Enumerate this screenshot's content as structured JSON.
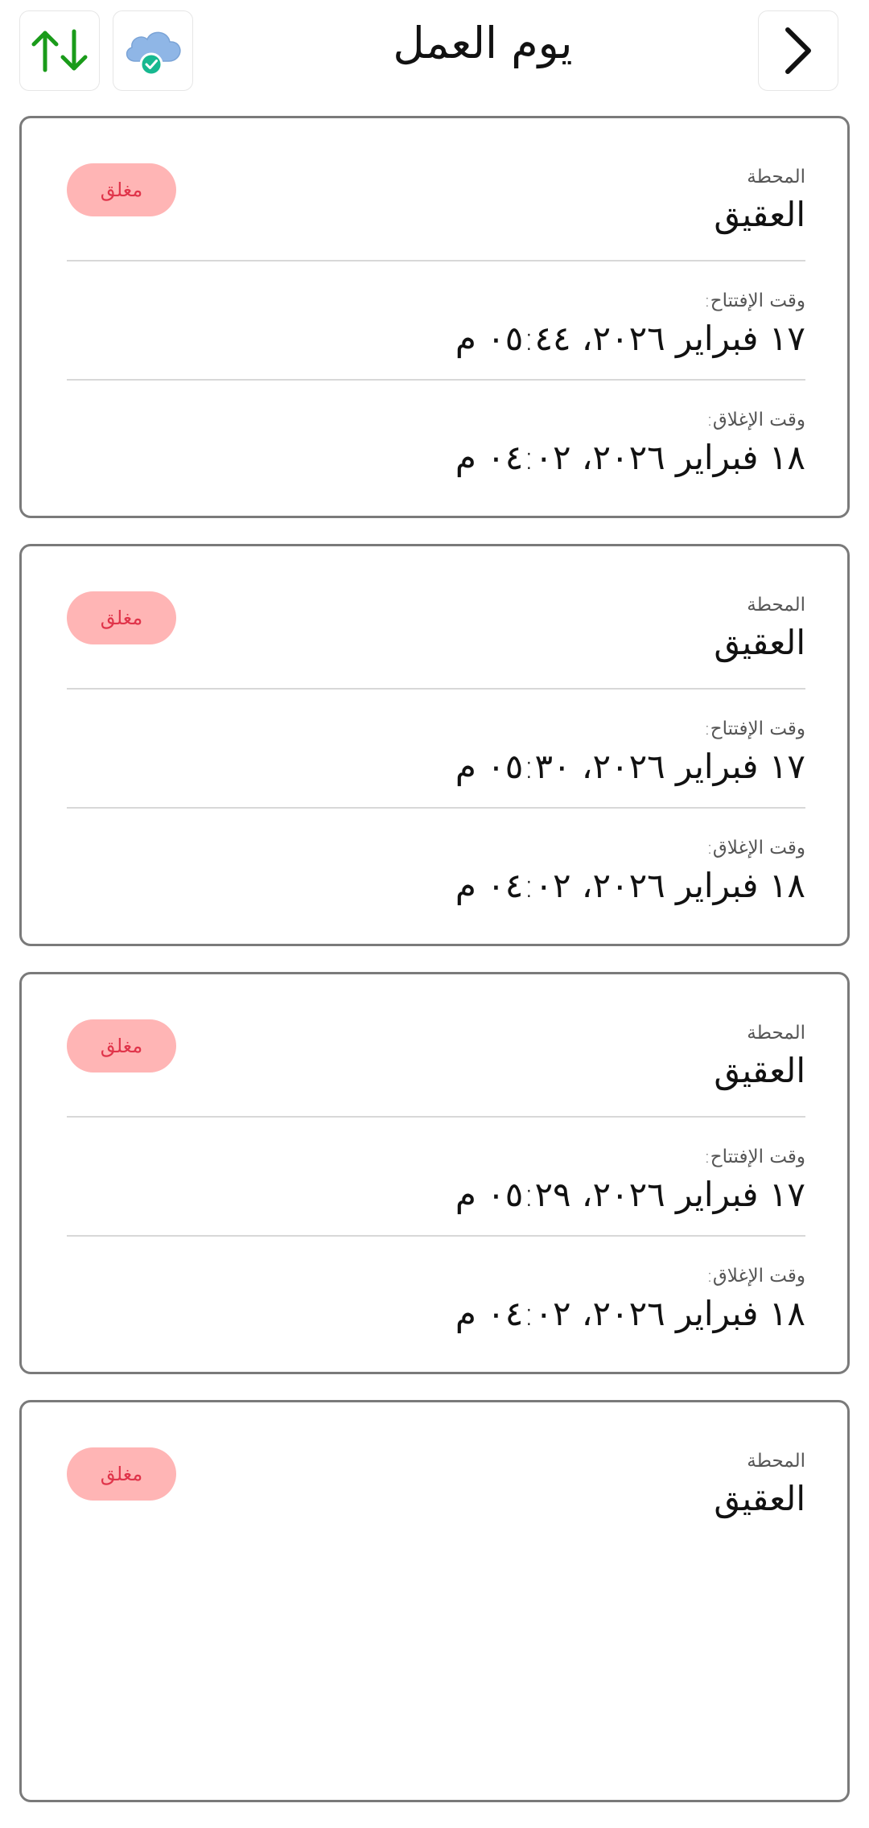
{
  "header": {
    "title": "يوم العمل",
    "sync_icon": "up-down-arrows-icon",
    "cloud_icon": "cloud-check-icon",
    "forward_icon": "chevron-right-icon"
  },
  "colors": {
    "arrow_green": "#1a9b1a",
    "cloud_blue": "#8fb6e6",
    "check_teal": "#17b890",
    "badge_bg": "#ffb5b5",
    "badge_text": "#e0344a"
  },
  "labels": {
    "station": "المحطة",
    "open_time": "وقت الإفتتاح:",
    "close_time": "وقت الإغلاق:"
  },
  "shifts": [
    {
      "station": "العقيق",
      "status": "مغلق",
      "open_time": "١٧ فبراير ٢٠٢٦، ٠٥:٤٤ م",
      "close_time": "١٨ فبراير ٢٠٢٦، ٠٤:٠٢ م"
    },
    {
      "station": "العقيق",
      "status": "مغلق",
      "open_time": "١٧ فبراير ٢٠٢٦، ٠٥:٣٠ م",
      "close_time": "١٨ فبراير ٢٠٢٦، ٠٤:٠٢ م"
    },
    {
      "station": "العقيق",
      "status": "مغلق",
      "open_time": "١٧ فبراير ٢٠٢٦، ٠٥:٢٩ م",
      "close_time": "١٨ فبراير ٢٠٢٦، ٠٤:٠٢ م"
    },
    {
      "station": "العقيق",
      "status": "مغلق",
      "open_time": "",
      "close_time": ""
    }
  ]
}
